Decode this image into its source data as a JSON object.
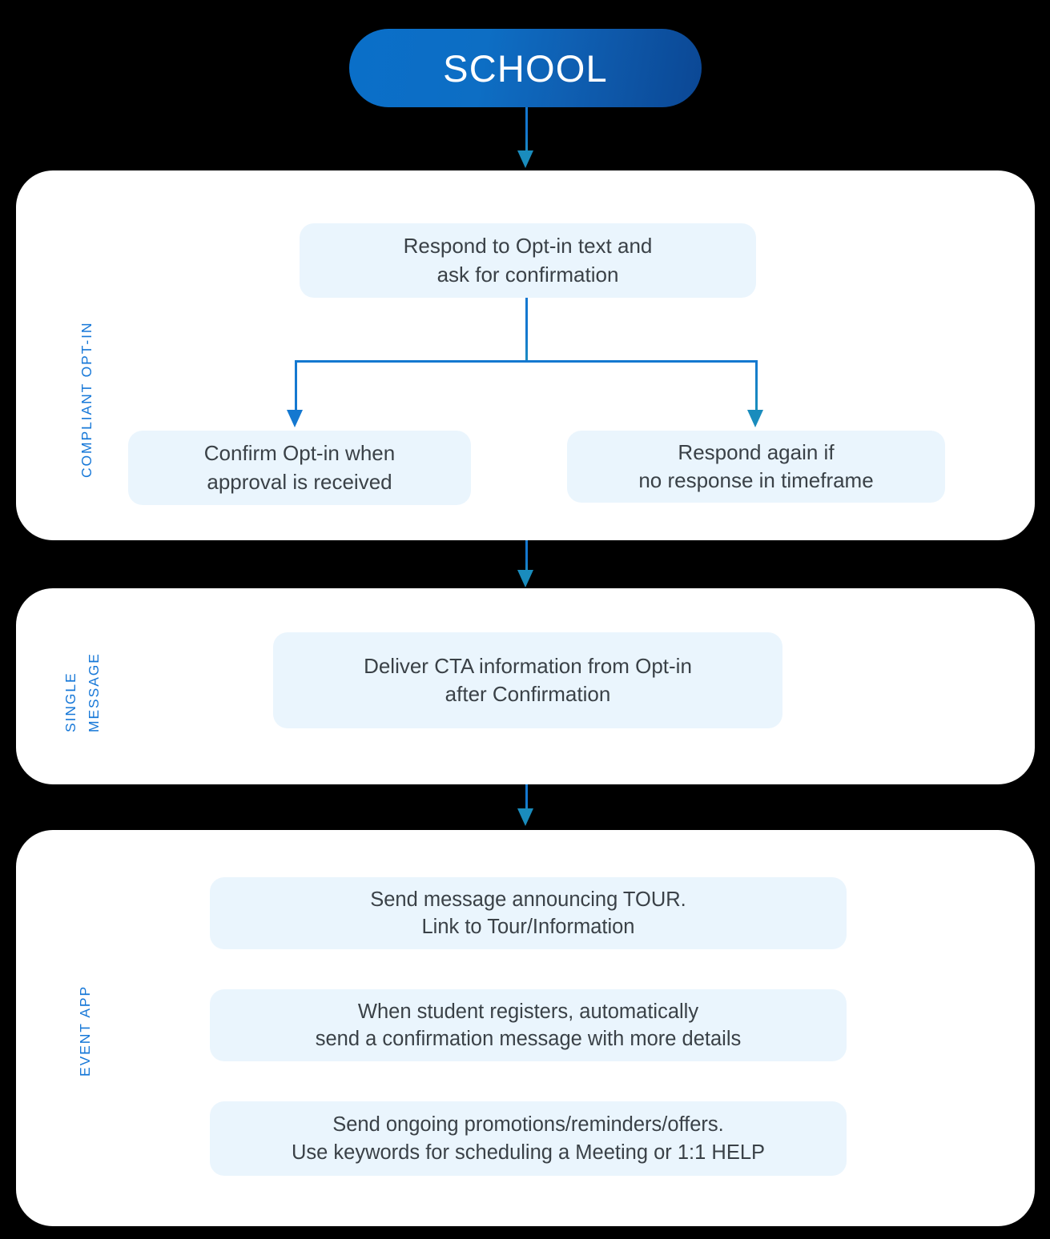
{
  "diagram": {
    "title": "SCHOOL",
    "root": {
      "label": "SCHOOL",
      "shape": "pill",
      "fill_gradient_from": "#0a6fc9",
      "fill_gradient_to": "#0b4794",
      "text_color": "#ffffff"
    },
    "accent_color": "#1778d8",
    "connector_color": "#1478d0",
    "connector_arrow_color": "#1a8cbd",
    "box_fill": "#eaf5fd",
    "box_text_color": "#3a4147",
    "panel_fill": "#ffffff",
    "sections": [
      {
        "id": "compliant-opt-in",
        "label": "COMPLIANT OPT-IN",
        "label_lines": [
          "COMPLIANT OPT-IN"
        ],
        "boxes": [
          {
            "id": "respond-optin",
            "lines": [
              "Respond to Opt-in text and",
              "ask for confirmation"
            ]
          },
          {
            "id": "confirm-optin",
            "lines": [
              "Confirm Opt-in when",
              "approval is received"
            ]
          },
          {
            "id": "respond-again",
            "lines": [
              "Respond again if",
              "no response in timeframe"
            ]
          }
        ]
      },
      {
        "id": "single-message",
        "label": "SINGLE MESSAGE",
        "label_lines": [
          "SINGLE",
          "MESSAGE"
        ],
        "boxes": [
          {
            "id": "deliver-cta",
            "lines": [
              "Deliver CTA information from Opt-in",
              "after Confirmation"
            ]
          }
        ]
      },
      {
        "id": "event-app",
        "label": "EVENT APP",
        "label_lines": [
          "EVENT APP"
        ],
        "boxes": [
          {
            "id": "announce-tour",
            "lines": [
              "Send message announcing TOUR.",
              "Link to Tour/Information"
            ]
          },
          {
            "id": "registration-confirmation",
            "lines": [
              "When student registers, automatically",
              "send a confirmation message with more details"
            ]
          },
          {
            "id": "ongoing-promotions",
            "lines": [
              "Send ongoing promotions/reminders/offers.",
              "Use keywords for scheduling a Meeting or 1:1 HELP"
            ]
          }
        ]
      }
    ]
  }
}
